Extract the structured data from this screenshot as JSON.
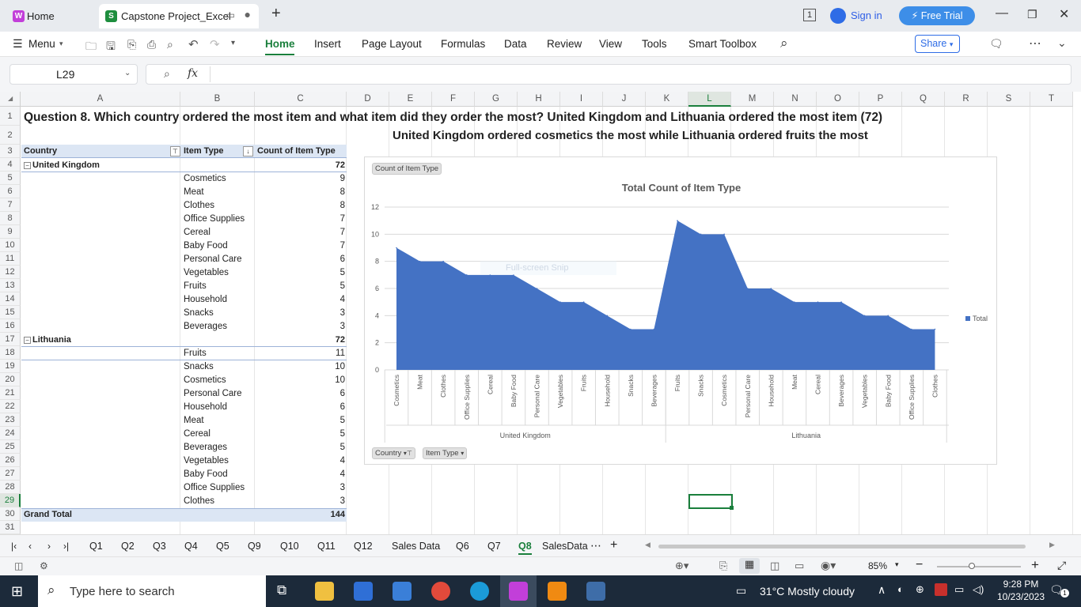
{
  "titlebar": {
    "home_tab": "Home",
    "file_tab": "Capstone Project_Excel",
    "sign_in": "Sign in",
    "free_trial": "Free Trial",
    "new_tab": "+"
  },
  "menubar": {
    "menu": "Menu",
    "items": [
      "Home",
      "Insert",
      "Page Layout",
      "Formulas",
      "Data",
      "Review",
      "View",
      "Tools",
      "Smart Toolbox"
    ],
    "share": "Share"
  },
  "formula": {
    "cell_ref": "L29",
    "fx": "fx",
    "value": ""
  },
  "columns": [
    "A",
    "B",
    "C",
    "D",
    "E",
    "F",
    "G",
    "H",
    "I",
    "J",
    "K",
    "L",
    "M",
    "N",
    "O",
    "P",
    "Q",
    "R",
    "S",
    "T"
  ],
  "rows": [
    "1",
    "2",
    "3",
    "4",
    "5",
    "6",
    "7",
    "8",
    "9",
    "10",
    "11",
    "12",
    "13",
    "14",
    "15",
    "16",
    "17",
    "18",
    "19",
    "20",
    "21",
    "22",
    "23",
    "24",
    "25",
    "26",
    "27",
    "28",
    "29",
    "30",
    "31"
  ],
  "sheet": {
    "question": "Question 8. Which country ordered the most item and what item did they order the most? United Kingdom and Lithuania ordered the most item (72)",
    "answer": "United Kingdom ordered cosmetics the most while Lithuania ordered fruits the most",
    "pivot_headers": [
      "Country",
      "Item Type",
      "Count of Item Type"
    ],
    "uk": {
      "name": "United Kingdom",
      "total": "72",
      "items": [
        {
          "item": "Cosmetics",
          "count": "9"
        },
        {
          "item": "Meat",
          "count": "8"
        },
        {
          "item": "Clothes",
          "count": "8"
        },
        {
          "item": "Office Supplies",
          "count": "7"
        },
        {
          "item": "Cereal",
          "count": "7"
        },
        {
          "item": "Baby Food",
          "count": "7"
        },
        {
          "item": "Personal Care",
          "count": "6"
        },
        {
          "item": "Vegetables",
          "count": "5"
        },
        {
          "item": "Fruits",
          "count": "5"
        },
        {
          "item": "Household",
          "count": "4"
        },
        {
          "item": "Snacks",
          "count": "3"
        },
        {
          "item": "Beverages",
          "count": "3"
        }
      ]
    },
    "lt": {
      "name": "Lithuania",
      "total": "72",
      "items": [
        {
          "item": "Fruits",
          "count": "11"
        },
        {
          "item": "Snacks",
          "count": "10"
        },
        {
          "item": "Cosmetics",
          "count": "10"
        },
        {
          "item": "Personal Care",
          "count": "6"
        },
        {
          "item": "Household",
          "count": "6"
        },
        {
          "item": "Meat",
          "count": "5"
        },
        {
          "item": "Cereal",
          "count": "5"
        },
        {
          "item": "Beverages",
          "count": "5"
        },
        {
          "item": "Vegetables",
          "count": "4"
        },
        {
          "item": "Baby Food",
          "count": "4"
        },
        {
          "item": "Office Supplies",
          "count": "3"
        },
        {
          "item": "Clothes",
          "count": "3"
        }
      ]
    },
    "grand_total_label": "Grand Total",
    "grand_total": "144"
  },
  "chart": {
    "field_button": "Count of Item Type",
    "filter_buttons": [
      "Country",
      "Item Type"
    ],
    "snip_overlay": "Full-screen Snip"
  },
  "chart_data": {
    "type": "area",
    "title": "Total Count of Item Type",
    "ylim": [
      0,
      12
    ],
    "yticks": [
      0,
      2,
      4,
      6,
      8,
      10,
      12
    ],
    "grid": true,
    "legend": "right",
    "series": [
      {
        "name": "Total",
        "color": "#4472c4",
        "values": [
          9,
          8,
          8,
          7,
          7,
          7,
          6,
          5,
          5,
          4,
          3,
          3,
          11,
          10,
          10,
          6,
          6,
          5,
          5,
          5,
          4,
          4,
          3,
          3
        ]
      }
    ],
    "categories": [
      "Cosmetics",
      "Meat",
      "Clothes",
      "Office Supplies",
      "Cereal",
      "Baby Food",
      "Personal Care",
      "Vegetables",
      "Fruits",
      "Household",
      "Snacks",
      "Beverages",
      "Fruits",
      "Snacks",
      "Cosmetics",
      "Personal Care",
      "Household",
      "Meat",
      "Cereal",
      "Beverages",
      "Vegetables",
      "Baby Food",
      "Office Supplies",
      "Clothes"
    ],
    "groups": [
      {
        "name": "United Kingdom",
        "count": 12
      },
      {
        "name": "Lithuania",
        "count": 12
      }
    ]
  },
  "sheet_tabs": [
    "Q1",
    "Q2",
    "Q3",
    "Q4",
    "Q5",
    "Q9",
    "Q10",
    "Q11",
    "Q12",
    "Sales Data",
    "Q6",
    "Q7",
    "Q8",
    "SalesData"
  ],
  "active_tab": "Q8",
  "status": {
    "zoom": "85%"
  },
  "taskbar": {
    "search_placeholder": "Type here to search",
    "weather": "31°C  Mostly cloudy",
    "time": "9:28 PM",
    "date": "10/23/2023",
    "notif_count": "1"
  }
}
